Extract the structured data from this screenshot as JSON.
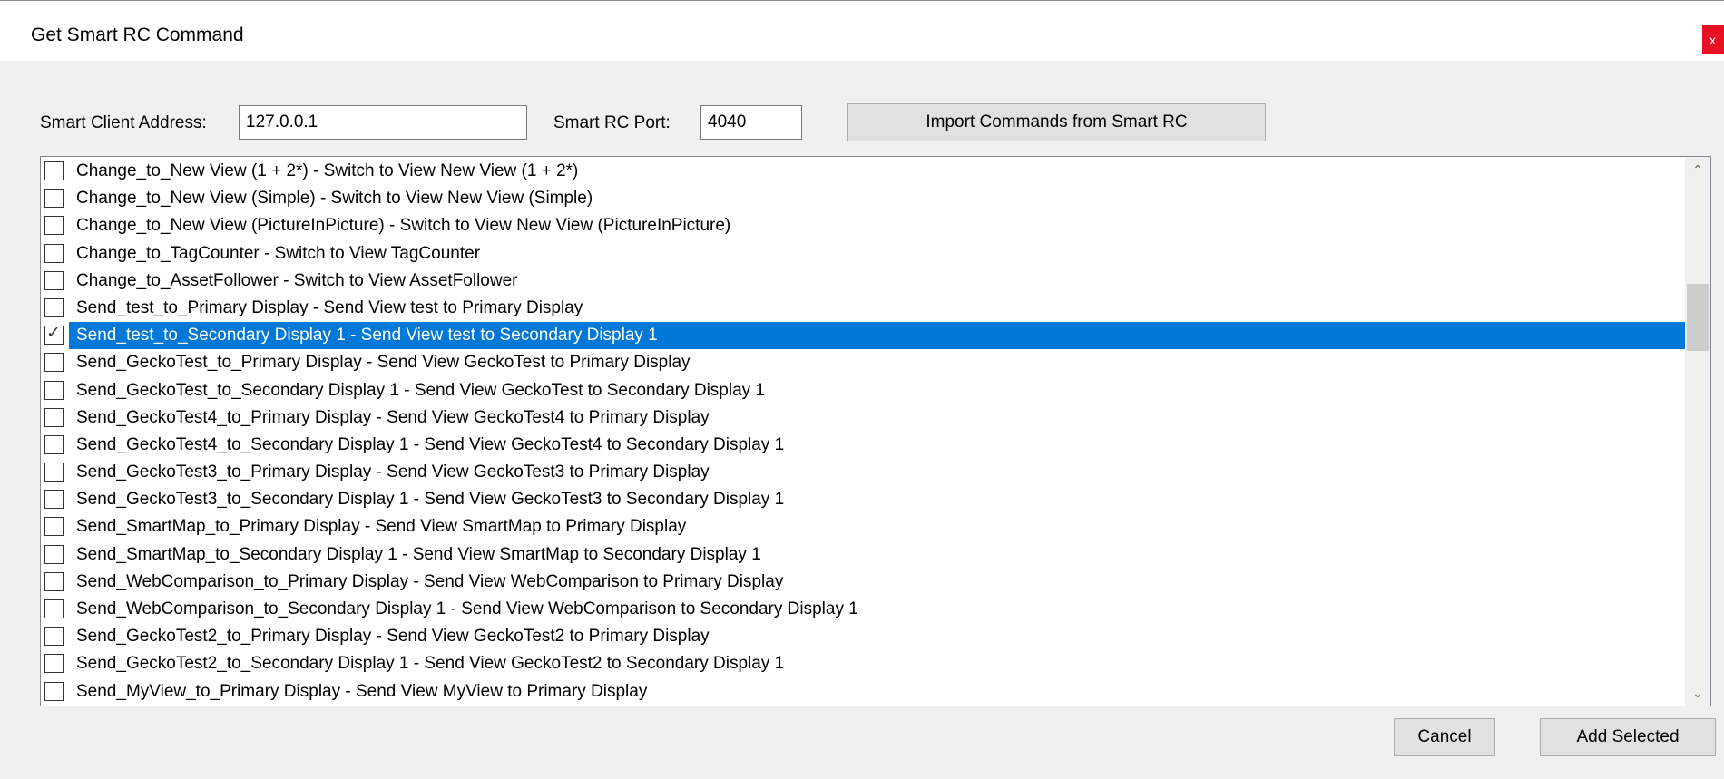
{
  "window": {
    "title": "Get Smart RC Command",
    "close_label": "x"
  },
  "form": {
    "address_label": "Smart Client Address:",
    "address_value": "127.0.0.1",
    "port_label": "Smart RC Port:",
    "port_value": "4040",
    "import_button": "Import Commands from Smart RC"
  },
  "commands": [
    {
      "label": "Change_to_New View (1 + 2*) - Switch to View New View (1 + 2*)",
      "checked": false,
      "selected": false
    },
    {
      "label": "Change_to_New View (Simple) - Switch to View New View (Simple)",
      "checked": false,
      "selected": false
    },
    {
      "label": "Change_to_New View (PictureInPicture) - Switch to View New View (PictureInPicture)",
      "checked": false,
      "selected": false
    },
    {
      "label": "Change_to_TagCounter - Switch to View TagCounter",
      "checked": false,
      "selected": false
    },
    {
      "label": "Change_to_AssetFollower - Switch to View AssetFollower",
      "checked": false,
      "selected": false
    },
    {
      "label": "Send_test_to_Primary Display - Send View test to Primary Display",
      "checked": false,
      "selected": false
    },
    {
      "label": "Send_test_to_Secondary Display 1 - Send View test to Secondary Display 1",
      "checked": true,
      "selected": true
    },
    {
      "label": "Send_GeckoTest_to_Primary Display - Send View GeckoTest to Primary Display",
      "checked": false,
      "selected": false
    },
    {
      "label": "Send_GeckoTest_to_Secondary Display 1 - Send View GeckoTest to Secondary Display 1",
      "checked": false,
      "selected": false
    },
    {
      "label": "Send_GeckoTest4_to_Primary Display - Send View GeckoTest4 to Primary Display",
      "checked": false,
      "selected": false
    },
    {
      "label": "Send_GeckoTest4_to_Secondary Display 1 - Send View GeckoTest4 to Secondary Display 1",
      "checked": false,
      "selected": false
    },
    {
      "label": "Send_GeckoTest3_to_Primary Display - Send View GeckoTest3 to Primary Display",
      "checked": false,
      "selected": false
    },
    {
      "label": "Send_GeckoTest3_to_Secondary Display 1 - Send View GeckoTest3 to Secondary Display 1",
      "checked": false,
      "selected": false
    },
    {
      "label": "Send_SmartMap_to_Primary Display - Send View SmartMap to Primary Display",
      "checked": false,
      "selected": false
    },
    {
      "label": "Send_SmartMap_to_Secondary Display 1 - Send View SmartMap to Secondary Display 1",
      "checked": false,
      "selected": false
    },
    {
      "label": "Send_WebComparison_to_Primary Display - Send View WebComparison to Primary Display",
      "checked": false,
      "selected": false
    },
    {
      "label": "Send_WebComparison_to_Secondary Display 1 - Send View WebComparison to Secondary Display 1",
      "checked": false,
      "selected": false
    },
    {
      "label": "Send_GeckoTest2_to_Primary Display - Send View GeckoTest2 to Primary Display",
      "checked": false,
      "selected": false
    },
    {
      "label": "Send_GeckoTest2_to_Secondary Display 1 - Send View GeckoTest2 to Secondary Display 1",
      "checked": false,
      "selected": false
    },
    {
      "label": "Send_MyView_to_Primary Display - Send View MyView to Primary Display",
      "checked": false,
      "selected": false
    }
  ],
  "scrollbar": {
    "up_icon": "chevron-up-icon",
    "down_icon": "chevron-down-icon"
  },
  "footer": {
    "cancel_button": "Cancel",
    "add_button": "Add Selected"
  },
  "colors": {
    "selection": "#0078d7",
    "close": "#e81123"
  }
}
